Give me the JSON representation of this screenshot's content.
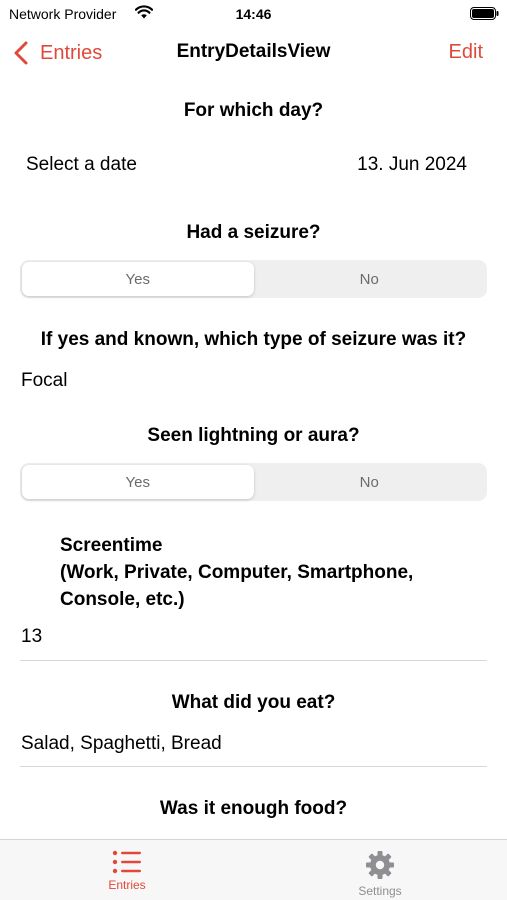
{
  "status_bar": {
    "carrier": "Network Provider",
    "time": "14:46"
  },
  "nav": {
    "back_label": "Entries",
    "title": "EntryDetailsView",
    "edit_label": "Edit"
  },
  "form": {
    "day_question": "For which day?",
    "date_label": "Select a date",
    "date_value": "13. Jun 2024",
    "seizure_question": "Had a seizure?",
    "seizure_options": [
      "Yes",
      "No"
    ],
    "seizure_type_question": "If yes and known, which type of seizure was it?",
    "seizure_type_value": "Focal",
    "aura_question": "Seen lightning or aura?",
    "aura_options": [
      "Yes",
      "No"
    ],
    "screentime_title_line1": "Screentime",
    "screentime_title_line2": "(Work, Private, Computer, Smartphone,",
    "screentime_title_line3": "Console, etc.)",
    "screentime_value": "13",
    "food_question": "What did you eat?",
    "food_value": "Salad, Spaghetti, Bread",
    "enough_food_question": "Was it enough food?"
  },
  "tabs": [
    {
      "label": "Entries",
      "icon": "list-icon"
    },
    {
      "label": "Settings",
      "icon": "gear-icon"
    }
  ],
  "colors": {
    "accent": "#e0493a",
    "inactive": "#8e8e93"
  }
}
